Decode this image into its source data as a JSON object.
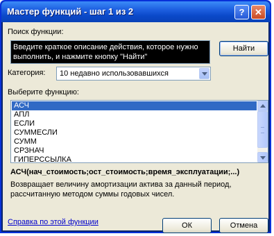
{
  "window": {
    "title": "Мастер функций - шаг 1 из 2",
    "help_button": "?",
    "close_button": "✕"
  },
  "search": {
    "label": "Поиск функции:",
    "value": "Введите краткое описание действия, которое нужно выполнить, и нажмите кнопку \"Найти\"",
    "find_button": "Найти"
  },
  "category": {
    "label": "Категория:",
    "selected": "10 недавно использовавшихся"
  },
  "functions": {
    "label": "Выберите функцию:",
    "items": [
      "АСЧ",
      "АПЛ",
      "ЕСЛИ",
      "СУММЕСЛИ",
      "СУММ",
      "СРЗНАЧ",
      "ГИПЕРССЫЛКА"
    ],
    "selected_index": 0
  },
  "details": {
    "signature": "АСЧ(нач_стоимость;ост_стоимость;время_эксплуатации;...)",
    "description": "Возвращает величину амортизации актива за данный период, рассчитанную методом суммы годовых чисел."
  },
  "footer": {
    "help_link": "Справка по этой функции",
    "ok_button": "ОК",
    "cancel_button": "Отмена"
  }
}
